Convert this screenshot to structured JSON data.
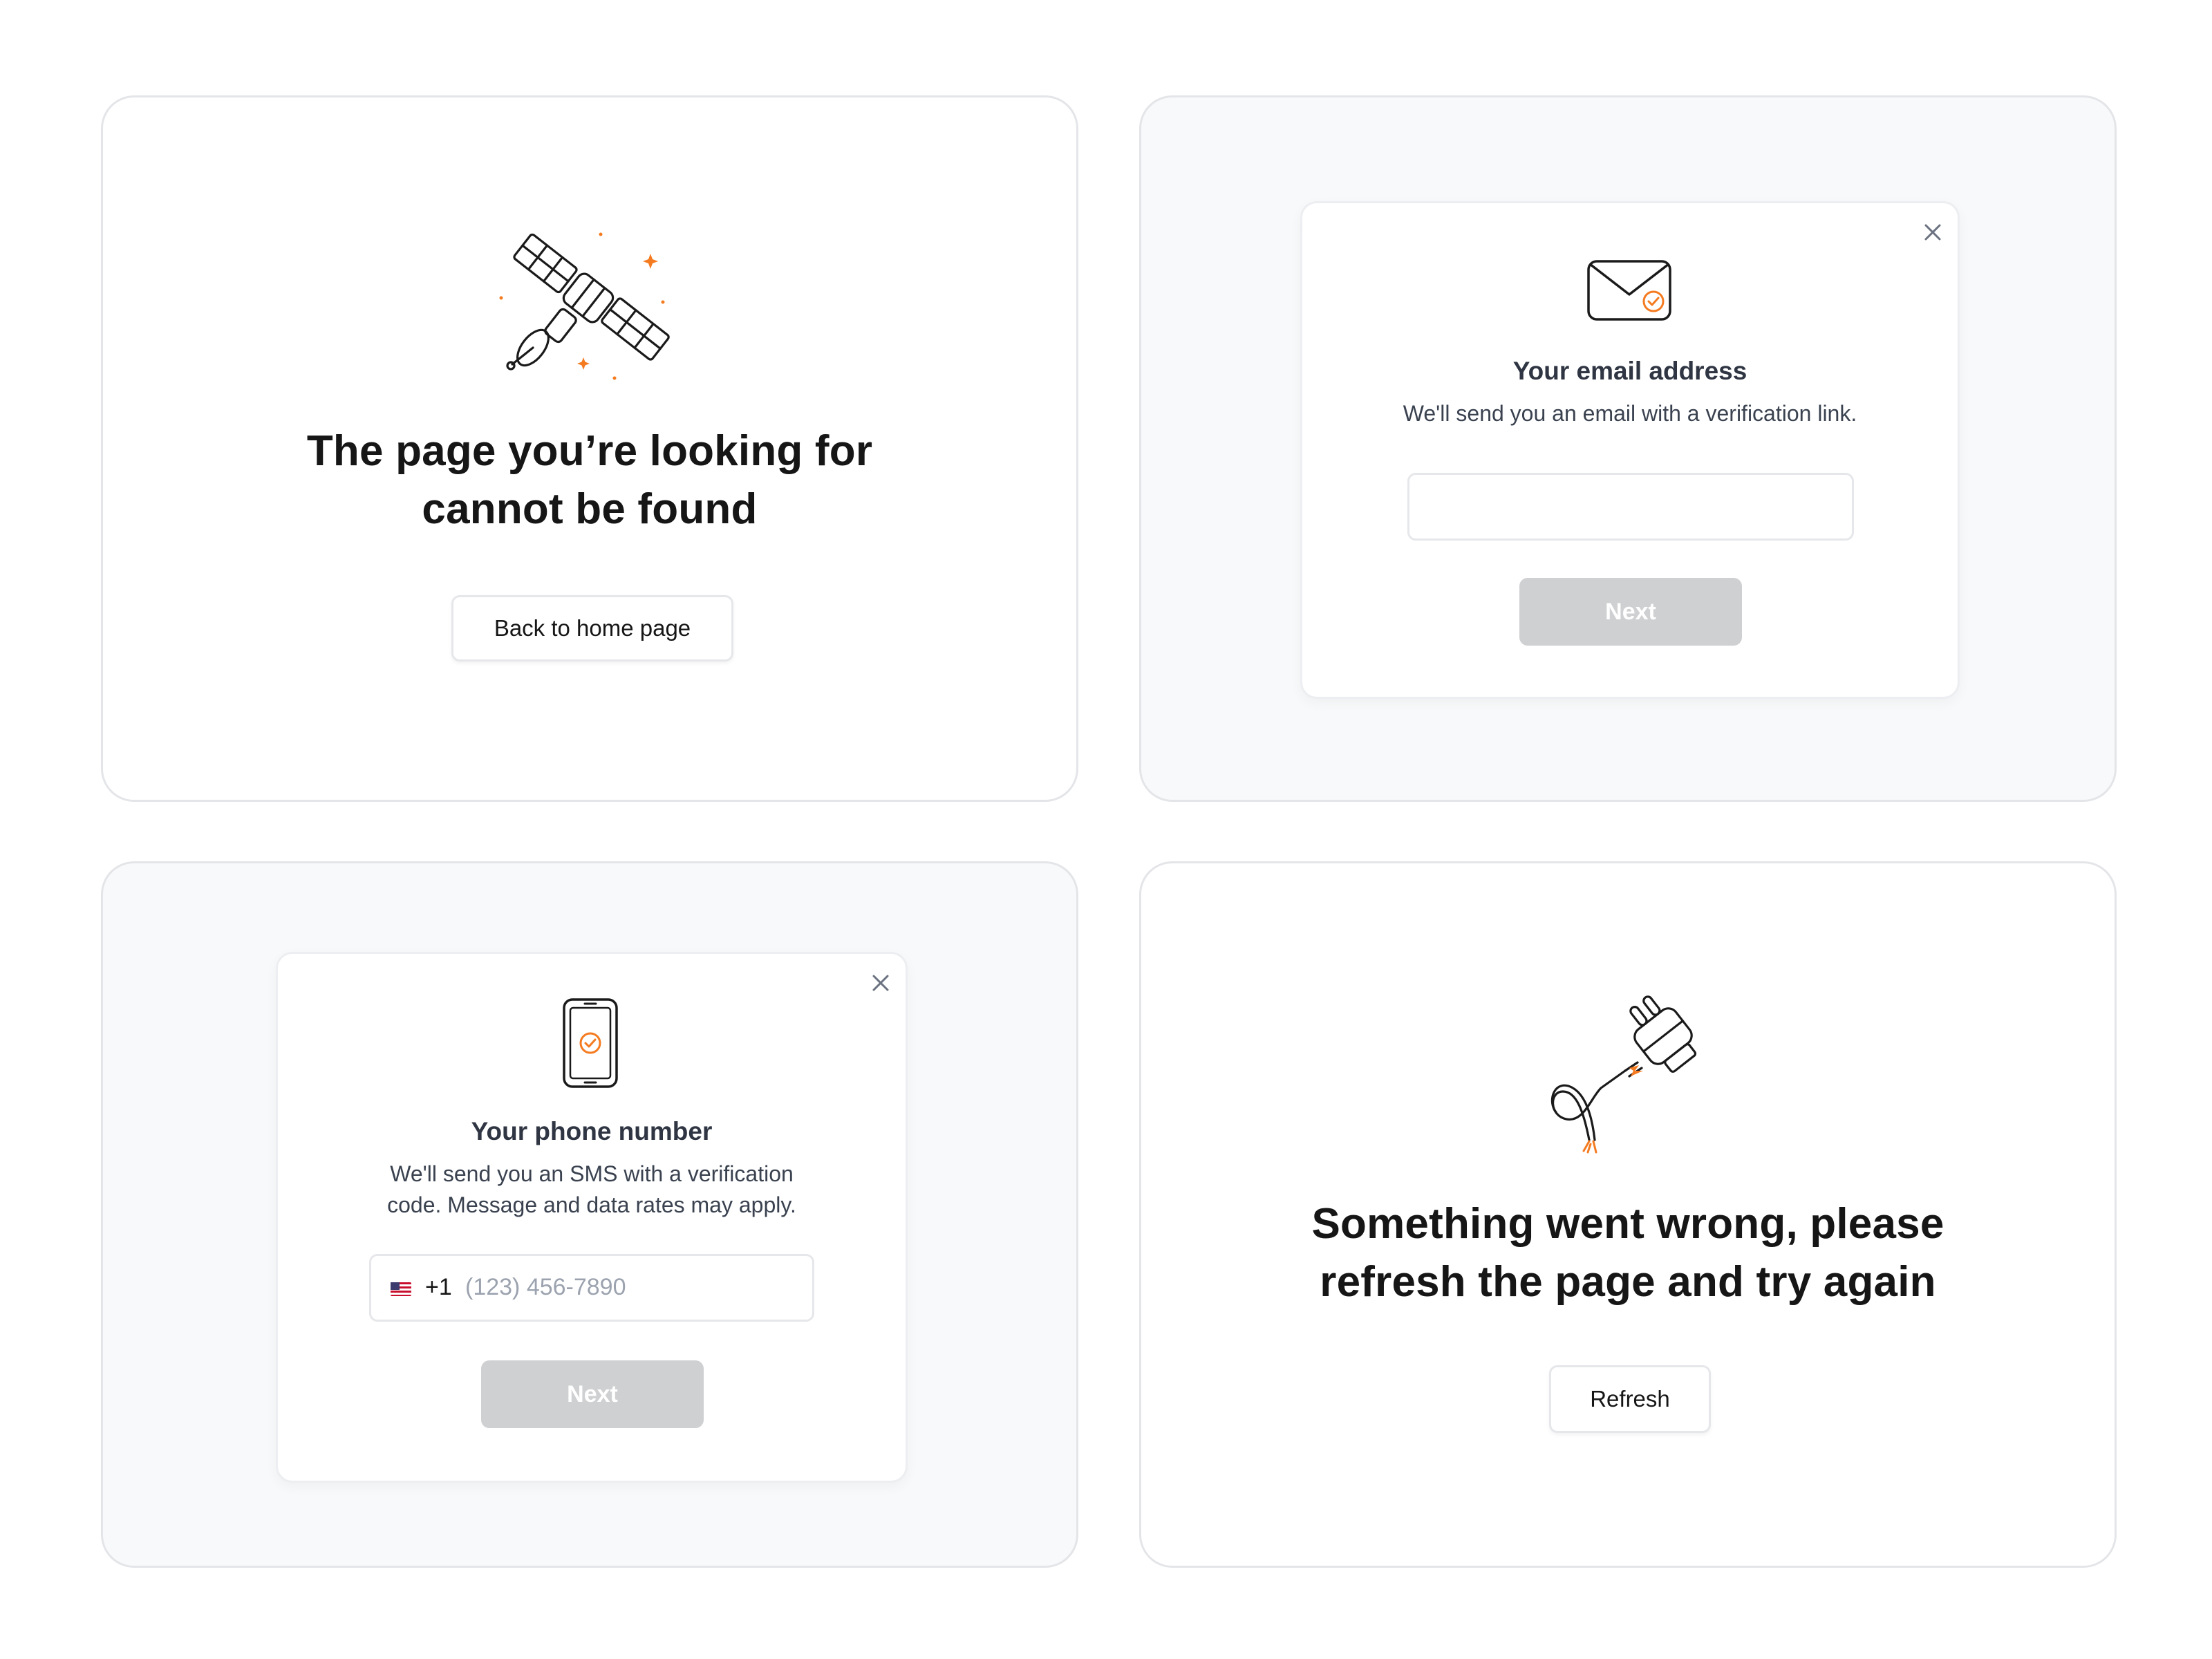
{
  "not_found": {
    "title_line1": "The page you’re looking for",
    "title_line2": "cannot be found",
    "button_label": "Back to home page",
    "illustration_icon": "satellite-icon"
  },
  "email_modal": {
    "title": "Your email address",
    "subtitle": "We'll send you an email with a verification link.",
    "input_value": "",
    "next_label": "Next",
    "icon": "envelope-check-icon"
  },
  "phone_modal": {
    "title": "Your phone number",
    "subtitle_line1": "We'll send you an SMS with a verification",
    "subtitle_line2": "code. Message and data rates may apply.",
    "country_code": "+1",
    "placeholder": "(123) 456-7890",
    "next_label": "Next",
    "icon": "phone-check-icon",
    "flag_icon": "us-flag-icon"
  },
  "error": {
    "title_line1": "Something went wrong, please",
    "title_line2": "refresh the page and try again",
    "button_label": "Refresh",
    "illustration_icon": "unplugged-plug-icon"
  },
  "colors": {
    "accent": "#f47b20",
    "disabled_button": "#cfd0d2",
    "card_border": "#e4e5e8",
    "gray_card_bg": "#f8f9fa"
  }
}
